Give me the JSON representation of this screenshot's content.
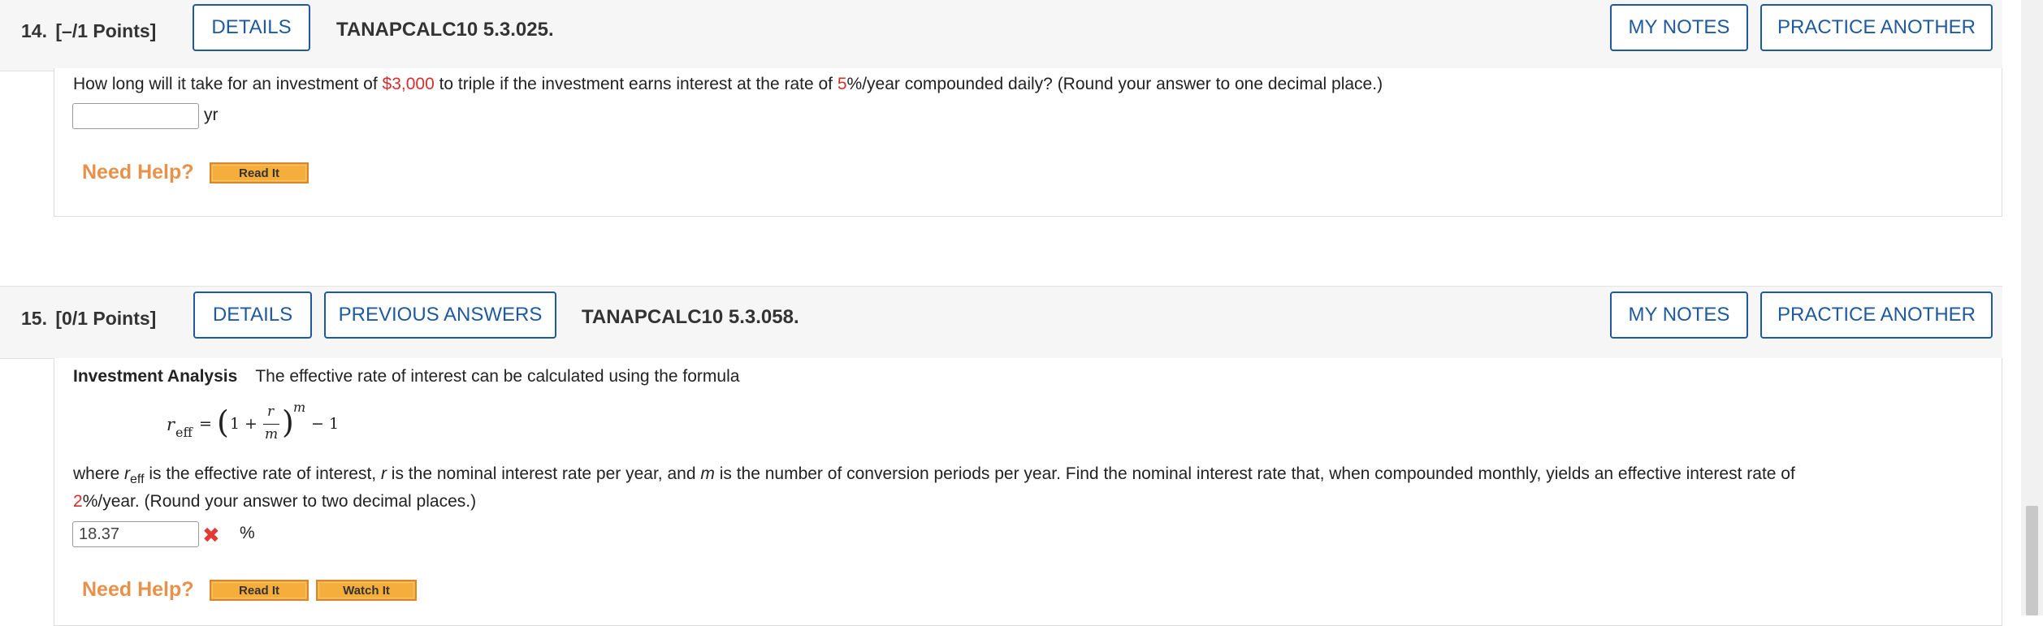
{
  "q14": {
    "number": "14.",
    "points": "[–/1 Points]",
    "details_label": "DETAILS",
    "code": "TANAPCALC10 5.3.025.",
    "my_notes_label": "MY NOTES",
    "practice_label": "PRACTICE ANOTHER",
    "question_pre": "How long will it take for an investment of ",
    "amount": "$3,000",
    "question_mid": " to triple if the investment earns interest at the rate of ",
    "rate": "5",
    "question_post": "%/year compounded daily? (Round your answer to one decimal place.)",
    "answer_value": "",
    "unit": "yr",
    "need_help": "Need Help?",
    "read_it": "Read It"
  },
  "q15": {
    "number": "15.",
    "points": "[0/1 Points]",
    "details_label": "DETAILS",
    "previous_answers_label": "PREVIOUS ANSWERS",
    "code": "TANAPCALC10 5.3.058.",
    "my_notes_label": "MY NOTES",
    "practice_label": "PRACTICE ANOTHER",
    "title": "Investment Analysis",
    "intro": "The effective rate of interest can be calculated using the formula",
    "formula": {
      "lhs": "r",
      "lhs_sub": "eff",
      "equals": "=",
      "one": "1",
      "plus": "+",
      "num": "r",
      "den": "m",
      "exp": "m",
      "minus_one": "− 1"
    },
    "where_1": "where ",
    "where_r": "r",
    "where_sub": "eff",
    "where_2": " is the effective rate of interest, ",
    "where_r2": "r",
    "where_3": " is the nominal interest rate per year, and ",
    "where_m": "m",
    "where_4": " is the number of conversion periods per year. Find the nominal interest rate that, when compounded monthly, yields an effective interest rate of",
    "line2_rate": "2",
    "line2_rest": "%/year. (Round your answer to two decimal places.)",
    "answer_value": "18.37",
    "unit": "%",
    "need_help": "Need Help?",
    "read_it": "Read It",
    "watch_it": "Watch It"
  },
  "colors": {
    "accent": "#1f5a9e",
    "highlight": "#d32f2f",
    "help": "#e8914a",
    "help_button": "#f5ae3b",
    "incorrect": "#e53935"
  }
}
